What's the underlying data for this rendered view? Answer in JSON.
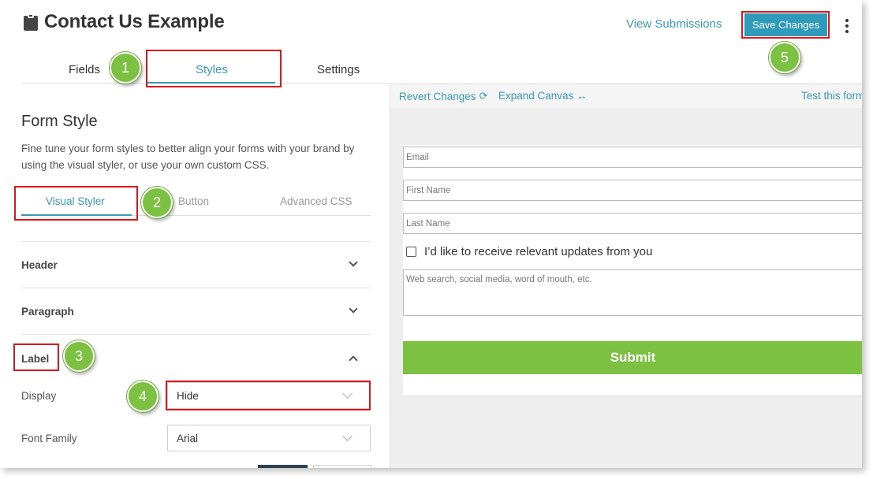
{
  "header": {
    "title": "Contact Us Example",
    "view_submissions": "View Submissions",
    "save_changes": "Save Changes",
    "tabs": [
      {
        "label": "Fields"
      },
      {
        "label": "Styles"
      },
      {
        "label": "Settings"
      }
    ]
  },
  "left_panel": {
    "heading": "Form Style",
    "description": "Fine tune your form styles to better align your forms with your brand by using the visual styler, or use your own custom CSS.",
    "subtabs": [
      {
        "label": "Visual Styler"
      },
      {
        "label": "Button"
      },
      {
        "label": "Advanced CSS"
      }
    ],
    "sections": [
      {
        "label": "Header"
      },
      {
        "label": "Paragraph"
      },
      {
        "label": "Label"
      }
    ],
    "label_settings": {
      "display_label": "Display",
      "display_value": "Hide",
      "font_family_label": "Font Family",
      "font_family_value": "Arial"
    }
  },
  "canvas": {
    "revert": "Revert Changes",
    "expand": "Expand Canvas",
    "test": "Test this form",
    "fields": {
      "email": "Email",
      "first_name": "First Name",
      "last_name": "Last Name",
      "checkbox_label": "I’d like to receive relevant updates from you",
      "textarea_placeholder": "Web search, social media, word of mouth, etc.",
      "submit": "Submit"
    }
  },
  "steps": [
    "1",
    "2",
    "3",
    "4",
    "5"
  ],
  "colors": {
    "accent": "#3a98b5",
    "save_button": "#2e9bba",
    "submit_button": "#7dc142",
    "step_badge": "#7dc142",
    "highlight_box": "#e1141c"
  },
  "icons": {
    "title": "clipboard-icon",
    "menu": "kebab-menu-icon",
    "revert": "refresh-icon",
    "expand": "horizontal-arrows-icon"
  }
}
